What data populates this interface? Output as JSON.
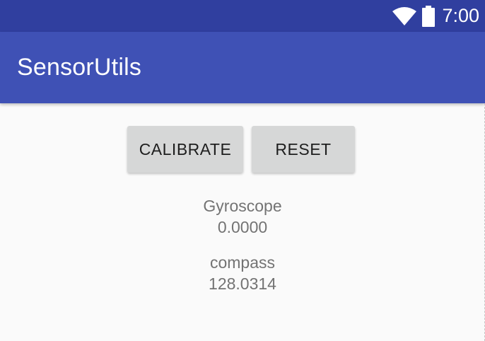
{
  "status_bar": {
    "time": "7:00",
    "icons": [
      "wifi-icon",
      "battery-icon"
    ],
    "background": "#303f9f"
  },
  "app_bar": {
    "title": "SensorUtils",
    "background": "#3f51b5"
  },
  "buttons": {
    "calibrate_label": "CALIBRATE",
    "reset_label": "RESET"
  },
  "sensors": {
    "gyroscope": {
      "label": "Gyroscope",
      "value": "0.0000"
    },
    "compass": {
      "label": "compass",
      "value": "128.0314"
    }
  }
}
